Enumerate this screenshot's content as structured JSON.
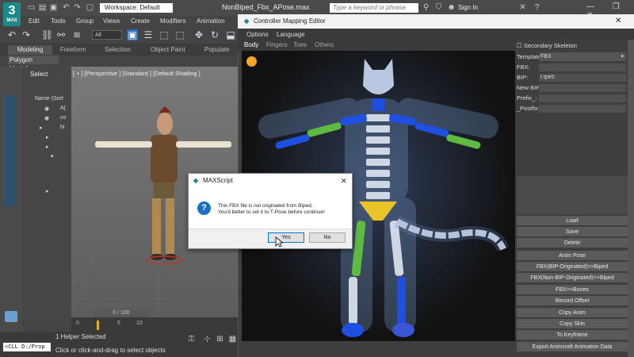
{
  "titlebar": {
    "app_logo": "3",
    "app_logo_sub": "MAX",
    "workspace": "Workspace: Default",
    "file_title": "NonBiped_Fbx_APose.max",
    "search_placeholder": "Type a keyword or phrase",
    "sign_in": "Sign In",
    "window_controls": "— ❐ ✕"
  },
  "menubar": {
    "items": [
      "Edit",
      "Tools",
      "Group",
      "Views",
      "Create",
      "Modifiers",
      "Animation"
    ]
  },
  "toolbar": {
    "selection_filter": "All"
  },
  "ribbon": {
    "tabs": [
      "Modeling",
      "Freeform",
      "Selection",
      "Object Paint",
      "Populate"
    ],
    "sub_label": "Polygon Modeling"
  },
  "explorer": {
    "select_label": "Select",
    "name_header": "Name (Sort",
    "items": [
      "A(",
      "co",
      "hi"
    ]
  },
  "viewport": {
    "label": "[ + ] [Perspective ] [Standard ] [Default Shading ]",
    "frame_counter": "0 / 100",
    "ticks": [
      "0",
      "5",
      "10"
    ]
  },
  "status": {
    "maxscript_prompt": "<CLL D:/Prop",
    "selected": "1 Helper Selected",
    "hint": "Click or click-and-drag to select objects"
  },
  "cme": {
    "title": "Controller Mapping Editor",
    "menu": [
      "Options",
      "Language"
    ],
    "tabs": [
      "Body",
      "Fingers",
      "Toes",
      "Others"
    ],
    "secondary_skeleton": "Secondary Skeleton",
    "template_label": "Template",
    "template_value": "FBX",
    "fields": [
      {
        "label": "FBX:",
        "value": ""
      },
      {
        "label": "BIP:",
        "value": "t tpe0"
      },
      {
        "label": "New BIP:",
        "value": ""
      },
      {
        "label": "Prefix_:",
        "value": ""
      },
      {
        "label": "_Postfix:",
        "value": ""
      }
    ],
    "buttons": [
      "Load",
      "Save",
      "Delete",
      "Anim Pose",
      "FBX(BIP-Originated)>>Biped",
      "FBX(Non-BIP-Originated)>>Biped",
      "FBX>>Bones",
      "Record Offset",
      "Copy Anim",
      "Copy Skin",
      "To Keyframe",
      "Export Animcraft Animation Data"
    ]
  },
  "dialog": {
    "title": "MAXScript",
    "message_line1": "This FBX file is not originated from Biped,",
    "message_line2": "You'd better to set it to T-Pose before continue!",
    "yes": "Yes",
    "no": "No",
    "close": "✕"
  },
  "colors": {
    "bone_blue": "#2f5fe0",
    "bone_green": "#5dbb3f",
    "bone_yellow": "#e8c428",
    "accent_orange": "#f5a623",
    "logo_teal": "#1b8a88"
  }
}
